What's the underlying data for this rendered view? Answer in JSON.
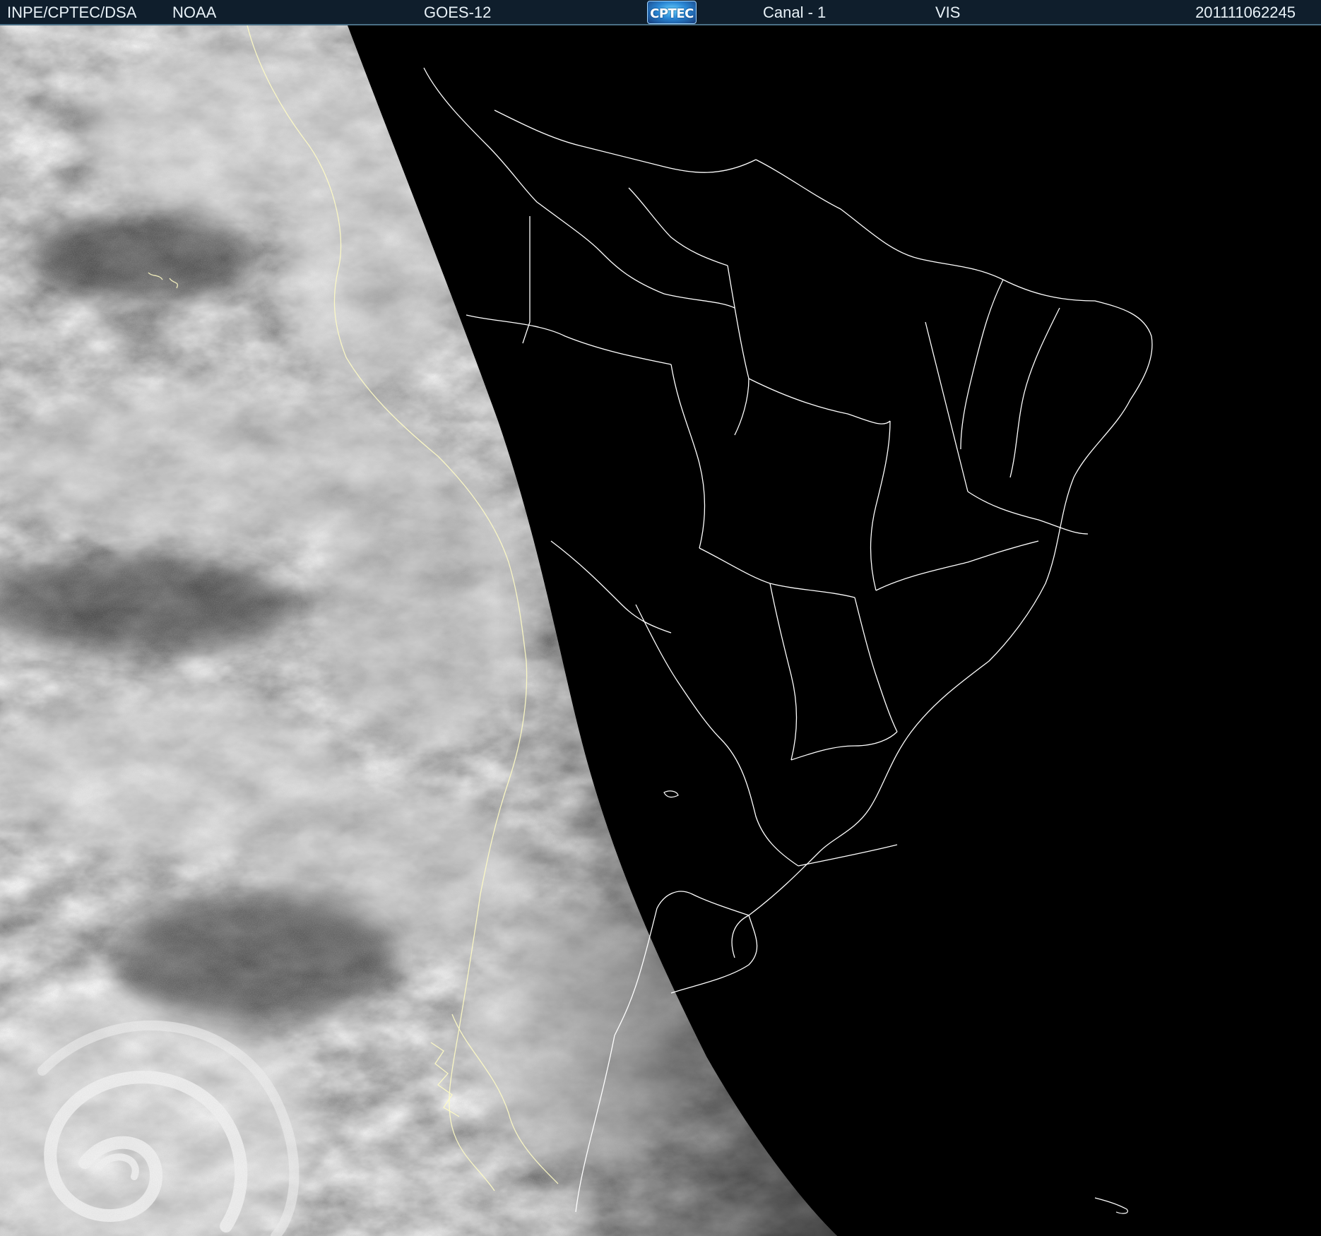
{
  "header": {
    "org": "INPE/CPTEC/DSA",
    "agency": "NOAA",
    "satellite": "GOES-12",
    "logo_text": "CPTEC",
    "channel": "Canal - 1",
    "band": "VIS",
    "timestamp": "201111062245"
  },
  "colors": {
    "header_bg": "#0f1e2c",
    "header_text": "#e9f2f8",
    "space": "#000000",
    "borders": "#ffffff",
    "coastline": "#fffcc4"
  },
  "icons": {
    "logo": "cptec-logo"
  }
}
